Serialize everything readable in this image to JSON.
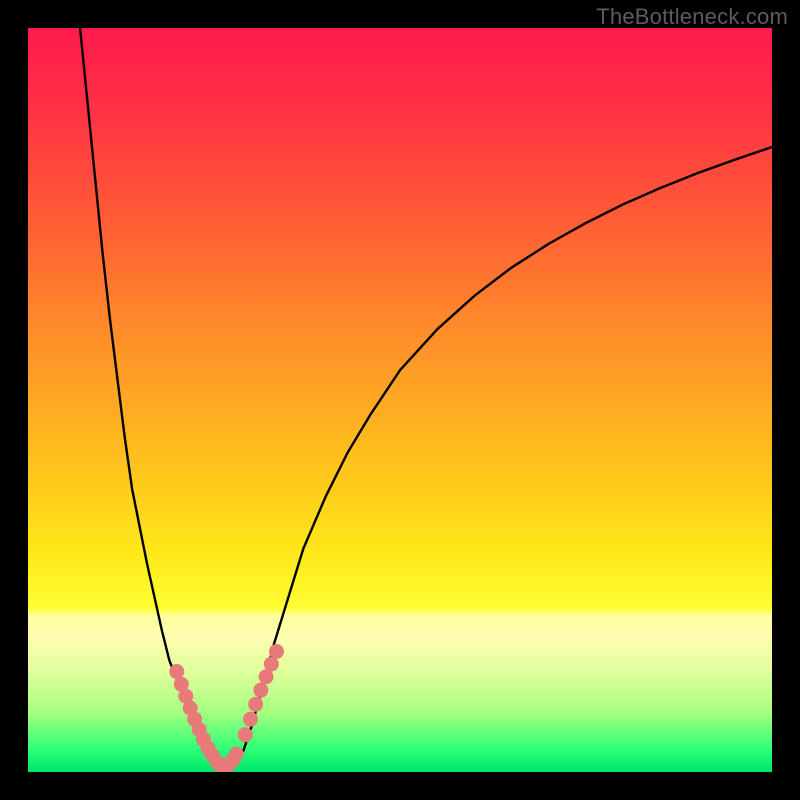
{
  "attribution": "TheBottleneck.com",
  "plot": {
    "margin_left": 28,
    "margin_top": 28,
    "inner_width": 744,
    "inner_height": 744
  },
  "gradient_stops": [
    {
      "offset": 0.0,
      "color": "#ff1a4d"
    },
    {
      "offset": 0.1,
      "color": "#ff2f44"
    },
    {
      "offset": 0.25,
      "color": "#ff5a36"
    },
    {
      "offset": 0.4,
      "color": "#ff8a2a"
    },
    {
      "offset": 0.55,
      "color": "#ffb71e"
    },
    {
      "offset": 0.7,
      "color": "#ffe619"
    },
    {
      "offset": 0.78,
      "color": "#ffff33"
    },
    {
      "offset": 0.79,
      "color": "#ffffa0"
    },
    {
      "offset": 0.82,
      "color": "#fdffb0"
    },
    {
      "offset": 0.86,
      "color": "#e4ff9e"
    },
    {
      "offset": 0.92,
      "color": "#a6ff80"
    },
    {
      "offset": 0.97,
      "color": "#2dff77"
    },
    {
      "offset": 1.0,
      "color": "#00e56a"
    }
  ],
  "chart_data": {
    "type": "line",
    "title": "",
    "xlabel": "",
    "ylabel": "",
    "xlim": [
      0,
      100
    ],
    "ylim": [
      0,
      100
    ],
    "x": [
      7,
      8,
      9,
      10,
      11,
      12,
      13,
      14,
      15,
      16,
      17,
      18,
      19,
      20,
      21,
      22,
      23,
      24,
      25,
      26,
      27,
      28,
      29,
      30,
      31,
      32,
      33,
      35,
      37,
      40,
      43,
      46,
      50,
      55,
      60,
      65,
      70,
      75,
      80,
      85,
      90,
      95,
      100
    ],
    "values": [
      100,
      90,
      80,
      70,
      61,
      53,
      45,
      38,
      33,
      28,
      23.5,
      19,
      15,
      12.5,
      10,
      7.5,
      5.5,
      3.5,
      2,
      1,
      0.5,
      1,
      3,
      6,
      9.5,
      13,
      17,
      23.5,
      30,
      37,
      43,
      48,
      54,
      59.5,
      64,
      67.8,
      71,
      73.8,
      76.3,
      78.5,
      80.5,
      82.3,
      84
    ],
    "marker_clusters": [
      {
        "side": "left",
        "x": [
          20.0,
          20.6,
          21.2,
          21.8,
          22.4,
          23.0,
          23.6,
          24.2,
          24.8
        ],
        "y": [
          13.5,
          11.8,
          10.2,
          8.6,
          7.1,
          5.7,
          4.4,
          3.2,
          2.2
        ]
      },
      {
        "side": "right",
        "x": [
          29.2,
          29.9,
          30.6,
          31.3,
          32.0,
          32.7,
          33.4
        ],
        "y": [
          5.0,
          7.1,
          9.1,
          11.0,
          12.8,
          14.5,
          16.2
        ]
      },
      {
        "side": "bottom",
        "x": [
          25.5,
          26.0,
          26.5,
          27.0,
          27.5,
          28.0
        ],
        "y": [
          1.2,
          0.8,
          0.7,
          1.0,
          1.6,
          2.4
        ]
      }
    ],
    "marker_color": "#e97a7a",
    "curve_color": "#000000"
  }
}
